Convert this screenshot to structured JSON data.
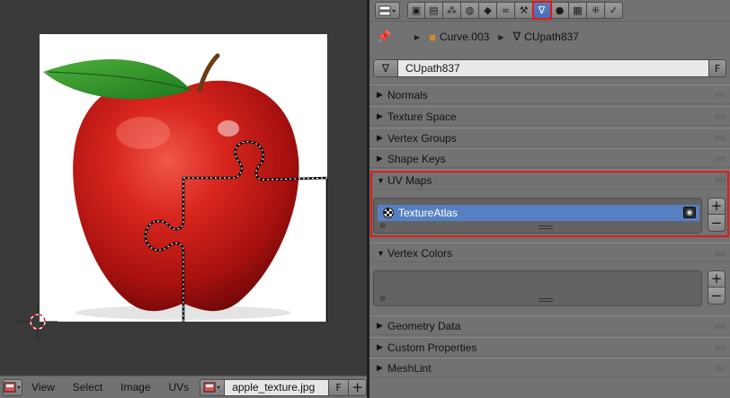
{
  "uv_editor": {
    "menus": [
      "View",
      "Select",
      "Image",
      "UVs"
    ],
    "image_name": "apple_texture.jpg",
    "fake_user_label": "F",
    "new_label": "+"
  },
  "properties": {
    "context_tabs": [
      "render",
      "render-layers",
      "scene",
      "world",
      "object",
      "constraints",
      "modifiers",
      "data",
      "material",
      "texture",
      "particles",
      "physics"
    ],
    "active_tab": "data",
    "breadcrumb": {
      "object": "Curve.003",
      "data": "CUpath837"
    },
    "datablock": {
      "name": "CUpath837",
      "fake_user_label": "F"
    },
    "panels": {
      "normals": "Normals",
      "texture_space": "Texture Space",
      "vertex_groups": "Vertex Groups",
      "shape_keys": "Shape Keys",
      "uv_maps": "UV Maps",
      "vertex_colors": "Vertex Colors",
      "geometry_data": "Geometry Data",
      "custom_properties": "Custom Properties",
      "meshlint": "MeshLint"
    },
    "uv_maps_list": [
      {
        "name": "TextureAtlas"
      }
    ],
    "add_label": "+",
    "remove_label": "−"
  },
  "colors": {
    "highlight": "#e01919",
    "selection": "#5680c2",
    "panel_bg": "#727272",
    "viewport_bg": "#3a3a3a"
  }
}
